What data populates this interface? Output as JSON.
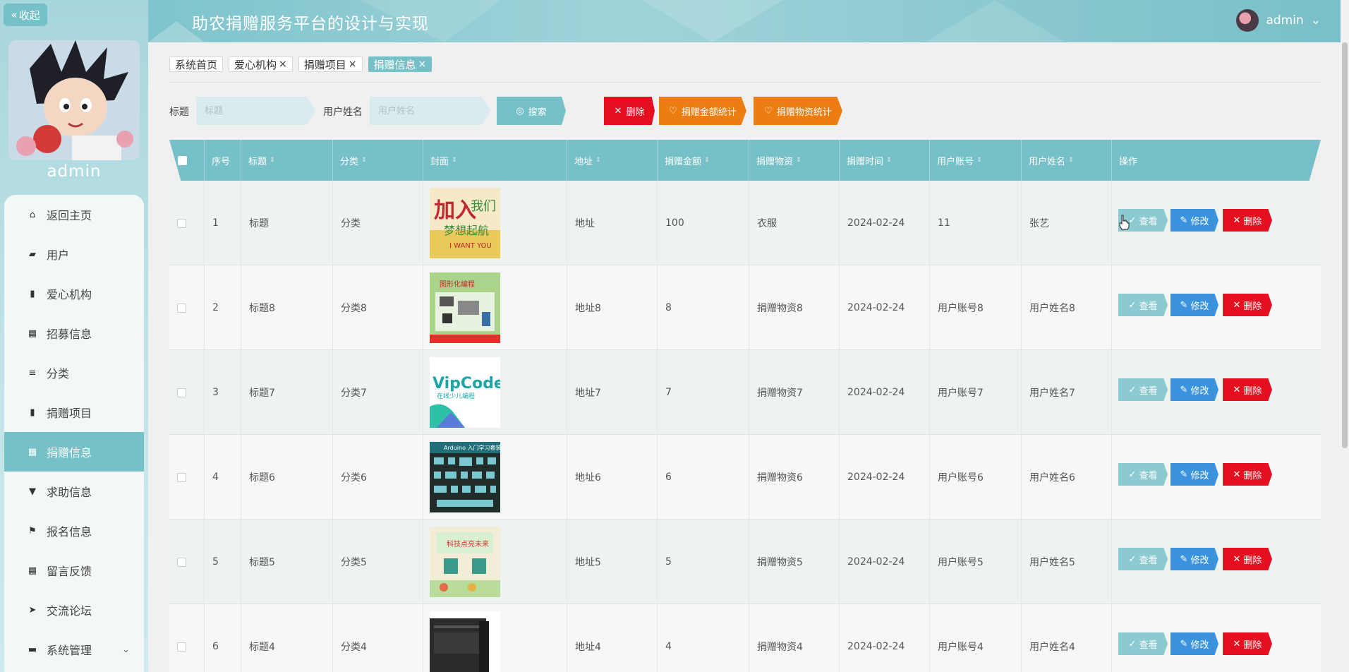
{
  "sidebar": {
    "collapse_label": "收起",
    "username": "admin",
    "menu": [
      {
        "label": "返回主页",
        "icon": "home-icon"
      },
      {
        "label": "用户",
        "icon": "chart-icon"
      },
      {
        "label": "爱心机构",
        "icon": "ticket-icon"
      },
      {
        "label": "招募信息",
        "icon": "grid-icon"
      },
      {
        "label": "分类",
        "icon": "list-icon"
      },
      {
        "label": "捐赠项目",
        "icon": "bar-icon"
      },
      {
        "label": "捐赠信息",
        "icon": "grid-icon",
        "active": true
      },
      {
        "label": "求助信息",
        "icon": "cup-icon"
      },
      {
        "label": "报名信息",
        "icon": "flag-icon"
      },
      {
        "label": "留言反馈",
        "icon": "grid-icon"
      },
      {
        "label": "交流论坛",
        "icon": "send-icon"
      },
      {
        "label": "系统管理",
        "icon": "briefcase-icon"
      }
    ]
  },
  "header": {
    "title": "助农捐赠服务平台的设计与实现",
    "username": "admin"
  },
  "tags": [
    {
      "label": "系统首页",
      "closable": false
    },
    {
      "label": "爱心机构",
      "closable": true
    },
    {
      "label": "捐赠项目",
      "closable": true
    },
    {
      "label": "捐赠信息",
      "closable": true,
      "active": true
    }
  ],
  "search": {
    "title_label": "标题",
    "title_placeholder": "标题",
    "name_label": "用户姓名",
    "name_placeholder": "用户姓名",
    "search_btn": "搜索",
    "delete_btn": "删除",
    "amount_stats_btn": "捐赠金额统计",
    "goods_stats_btn": "捐赠物资统计"
  },
  "table": {
    "columns": [
      "序号",
      "标题",
      "分类",
      "封面",
      "地址",
      "捐赠金额",
      "捐赠物资",
      "捐赠时间",
      "用户账号",
      "用户姓名",
      "操作"
    ],
    "actions": {
      "view": "查看",
      "edit": "修改",
      "delete": "删除"
    },
    "rows": [
      {
        "index": "1",
        "title": "标题",
        "category": "分类",
        "address": "地址",
        "amount": "100",
        "goods": "衣服",
        "time": "2024-02-24",
        "account": "11",
        "name": "张艺",
        "cover_text": "加入我们 梦想起航",
        "cover_sub": "I WANT YOU"
      },
      {
        "index": "2",
        "title": "标题8",
        "category": "分类8",
        "address": "地址8",
        "amount": "8",
        "goods": "捐赠物资8",
        "time": "2024-02-24",
        "account": "用户账号8",
        "name": "用户姓名8",
        "cover_text": "图形化编程入门套件"
      },
      {
        "index": "3",
        "title": "标题7",
        "category": "分类7",
        "address": "地址7",
        "amount": "7",
        "goods": "捐赠物资7",
        "time": "2024-02-24",
        "account": "用户账号7",
        "name": "用户姓名7",
        "cover_text": "VIPCODE",
        "cover_sub": "在线少儿编程"
      },
      {
        "index": "4",
        "title": "标题6",
        "category": "分类6",
        "address": "地址6",
        "amount": "6",
        "goods": "捐赠物资6",
        "time": "2024-02-24",
        "account": "用户账号6",
        "name": "用户姓名6",
        "cover_text": "Arduino 入门学习套装"
      },
      {
        "index": "5",
        "title": "标题5",
        "category": "分类5",
        "address": "地址5",
        "amount": "5",
        "goods": "捐赠物资5",
        "time": "2024-02-24",
        "account": "用户账号5",
        "name": "用户姓名5",
        "cover_text": "科技点亮未来"
      },
      {
        "index": "6",
        "title": "标题4",
        "category": "分类4",
        "address": "地址4",
        "amount": "4",
        "goods": "捐赠物资4",
        "time": "2024-02-24",
        "account": "用户账号4",
        "name": "用户姓名4",
        "cover_text": ""
      }
    ]
  },
  "colors": {
    "accent": "#76c0c8",
    "danger": "#e60f20",
    "warning": "#ec7d12",
    "primary": "#3b93de"
  }
}
